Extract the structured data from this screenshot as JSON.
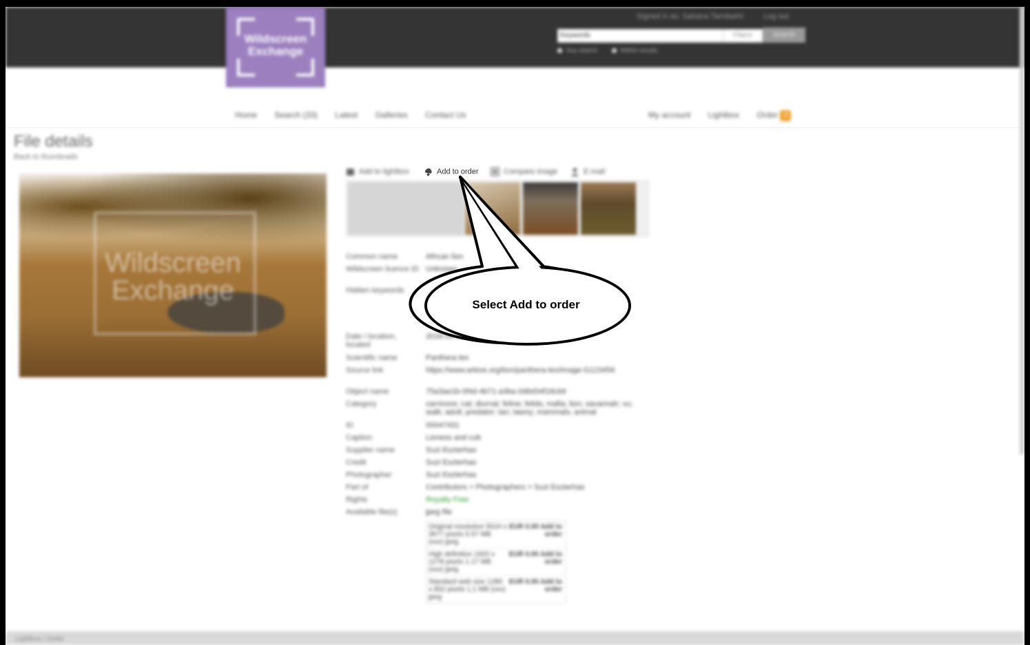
{
  "header": {
    "logo_text_1": "Wildscreen",
    "logo_text_2": "Exchange",
    "top_links": [
      "Signed in as: Sahana Tamilselvi",
      "Log out"
    ],
    "search": {
      "value": "Keywords",
      "filter": "Filters",
      "button": "Search"
    },
    "search_options": [
      "Any search",
      "Within results"
    ]
  },
  "nav": {
    "left": [
      "Home",
      "Search (33)",
      "Latest",
      "Galleries",
      "Contact Us"
    ],
    "right": [
      "My account",
      "Lightbox",
      "Order"
    ],
    "basket_count": "0"
  },
  "page": {
    "title": "File details",
    "subtitle": "Back to thumbnails"
  },
  "photo": {
    "watermark_1": "Wildscreen",
    "watermark_2": "Exchange"
  },
  "toolbar": {
    "add_lightbox": "Add to lightbox",
    "add_order": "Add to order",
    "compare": "Compare image",
    "email": "E-mail"
  },
  "details": [
    {
      "k": "Common name",
      "v": "African lion"
    },
    {
      "k": "Wildscreen licence ID",
      "v": "Unknown"
    },
    {
      "k": "Hidden keywords",
      "v": ""
    },
    {
      "k": "",
      "v": ""
    },
    {
      "k": "",
      "v": ""
    },
    {
      "k": "Date / location, located",
      "v": "2018-09-14 Kenya"
    },
    {
      "k": "Scientific name",
      "v": "Panthera leo"
    },
    {
      "k": "Source link",
      "v": "https://www.arkive.org/lion/panthera-leo/image-G123456"
    },
    {
      "k": "Object name",
      "v": "75a3ae1b-0f4d-4b71-a3ba-0d6d34f18cb9"
    },
    {
      "k": "Category",
      "v": "carnivore; cat; diurnal; feline; felids; mafia; lion; savannah; vu; walk; adult; predator; tan; tawny; mammals; animal"
    },
    {
      "k": "ID",
      "v": "00047431"
    },
    {
      "k": "Caption",
      "v": "Lioness and cub"
    },
    {
      "k": "Supplier name",
      "v": "Suzi Eszterhas"
    },
    {
      "k": "Credit",
      "v": "Suzi Eszterhas"
    },
    {
      "k": "Photographer",
      "v": "Suzi Eszterhas"
    },
    {
      "k": "Part of",
      "v": "Contributors > Photographers > Suzi Eszterhas"
    },
    {
      "k": "Rights",
      "v": "Royalty Free"
    },
    {
      "k": "Available file(s)",
      "v": "jpeg file"
    }
  ],
  "prices": [
    {
      "desc": "Original resolution 5524 x 3677 pixels 5.57 MB (xxx) jpeg",
      "price": "EUR 0.00 Add to order"
    },
    {
      "desc": "High definition 1920 x 1278 pixels 1.17 MB (xxx) jpeg",
      "price": "EUR 0.00 Add to order"
    },
    {
      "desc": "Standard web size 1280 x 852 pixels 1.1 MB (xxx) jpeg",
      "price": "EUR 0.00 Add to order"
    }
  ],
  "footer": {
    "text": "Lightbox / Order"
  },
  "callout": {
    "text": "Select Add to order"
  }
}
